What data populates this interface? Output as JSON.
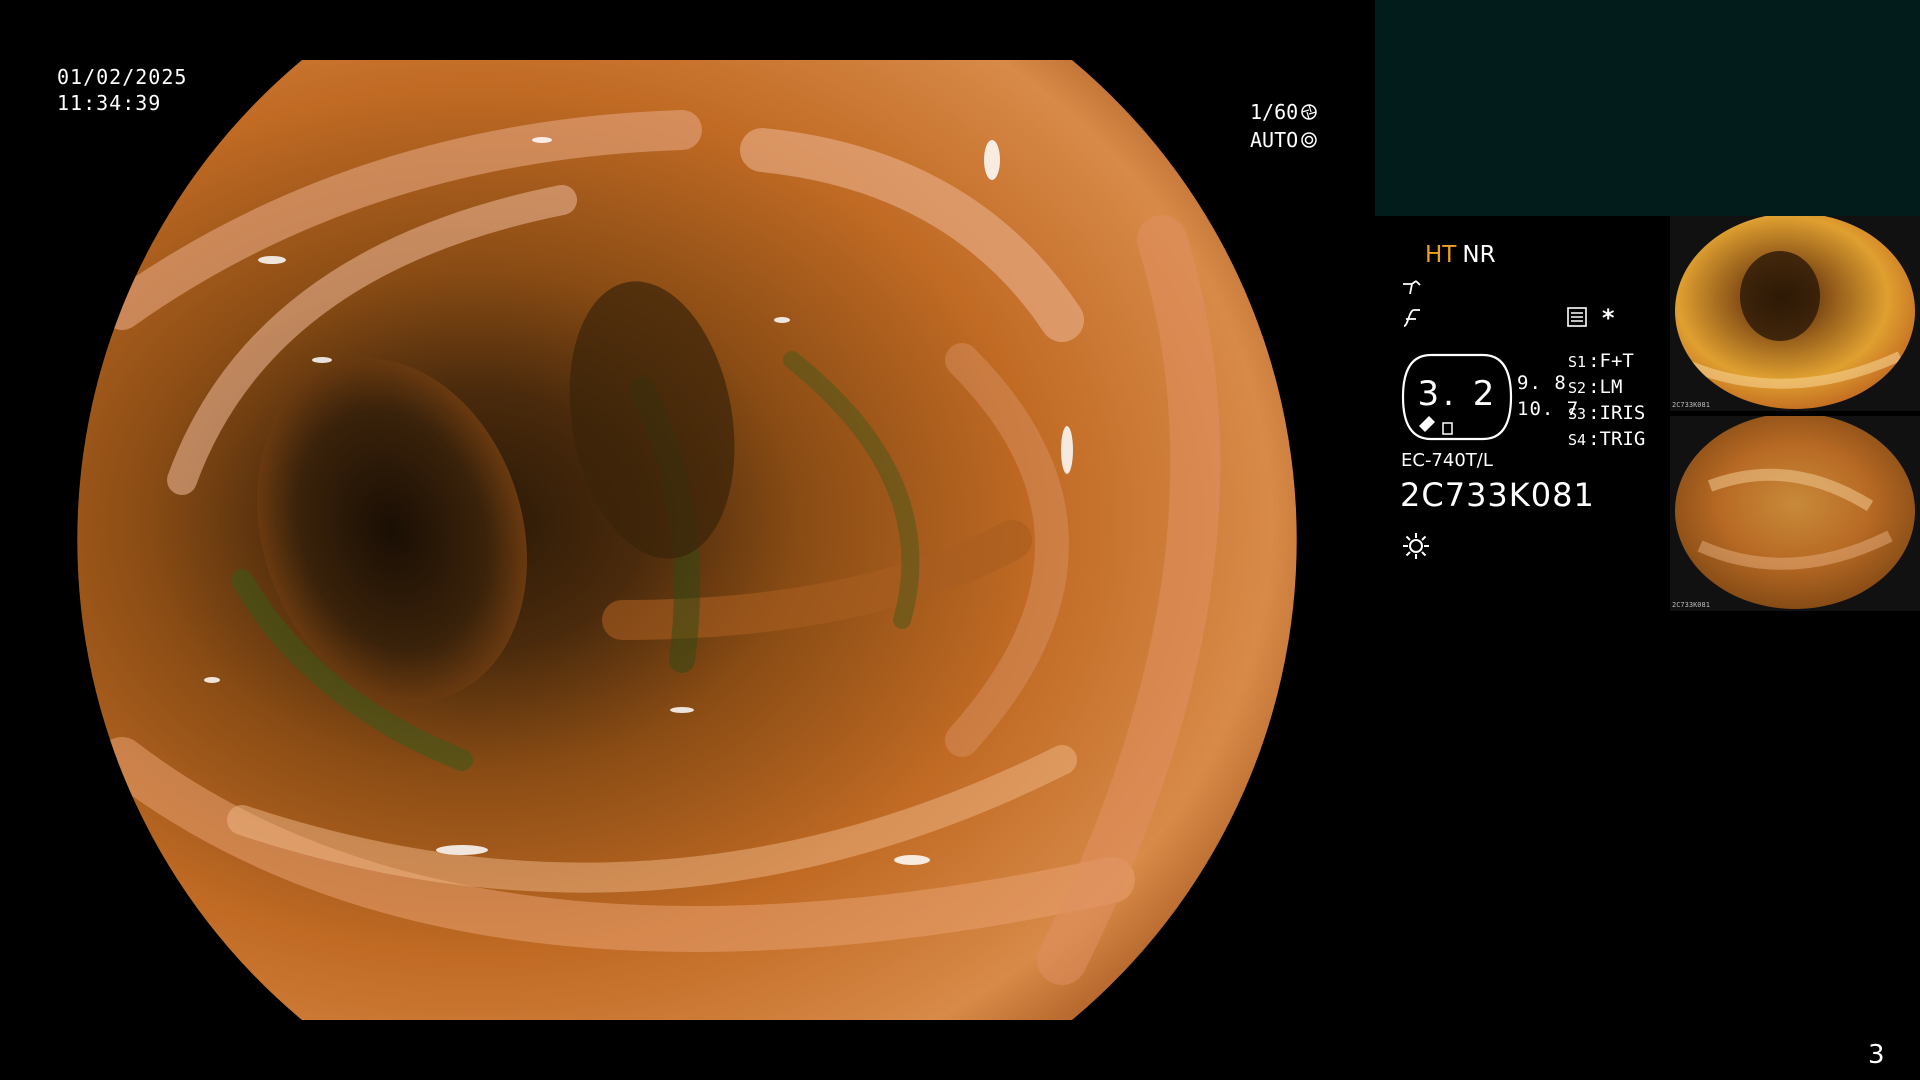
{
  "overlay": {
    "date": "01/02/2025",
    "time": "11:34:39",
    "shutter": "1/60",
    "exposure_mode": "AUTO"
  },
  "panel": {
    "mode_ht": "HT",
    "mode_nr": "NR",
    "dial_value": "3. 2",
    "side_value_top": "9. 8",
    "side_value_bottom": "10. 7",
    "switch_settings": [
      {
        "label": "S1",
        "value": "F+T"
      },
      {
        "label": "S2",
        "value": "LM"
      },
      {
        "label": "S3",
        "value": "IRIS"
      },
      {
        "label": "S4",
        "value": "TRIG"
      }
    ],
    "scope_model": "EC-740T/L",
    "scope_serial": "2C733K081"
  },
  "thumbnails": [
    {
      "caption": "2C733K081"
    },
    {
      "caption": "2C733K081"
    }
  ],
  "footer": {
    "page_number": "3"
  },
  "colors": {
    "background": "#000000",
    "teal_box": "#021b1b",
    "highlight": "#f0a020",
    "text": "#ffffff"
  },
  "icons": [
    "shutter-icon",
    "auto-iris-icon",
    "tool-icon",
    "curve-icon",
    "settings-icon",
    "sun-icon"
  ]
}
